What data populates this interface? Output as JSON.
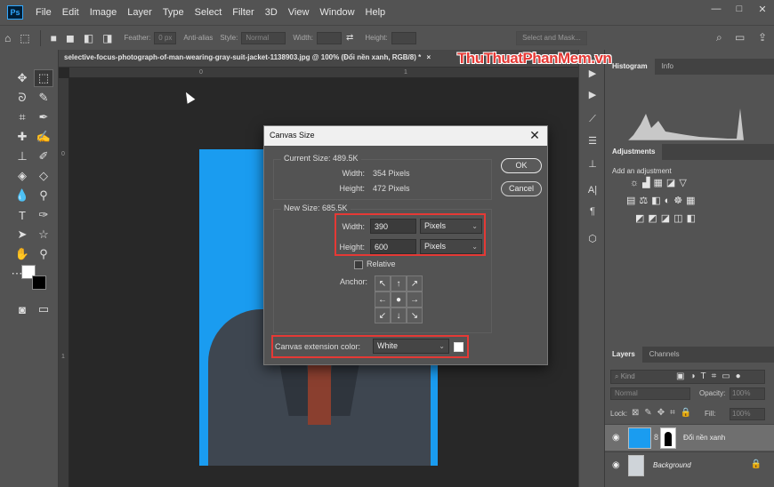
{
  "menubar": {
    "logo": "Ps",
    "items": [
      "File",
      "Edit",
      "Image",
      "Layer",
      "Type",
      "Select",
      "Filter",
      "3D",
      "View",
      "Window",
      "Help"
    ],
    "minimize": "—",
    "maximize": "□",
    "close": "✕"
  },
  "options": {
    "feather_label": "Feather:",
    "feather_value": "0 px",
    "antialias_label": "Anti-alias",
    "style_label": "Style:",
    "style_value": "Normal",
    "width_label": "Width:",
    "height_label": "Height:",
    "select_mask": "Select and Mask..."
  },
  "document": {
    "tab_title": "selective-focus-photograph-of-man-wearing-gray-suit-jacket-1138903.jpg @ 100% (Đổi nền xanh, RGB/8) *",
    "tab_close": "×",
    "watermark": "ThuThuatPhanMem.vn",
    "ruler_top": [
      "0",
      "1"
    ],
    "ruler_left": [
      "0",
      "1"
    ]
  },
  "dialog": {
    "title": "Canvas Size",
    "close": "✕",
    "current_size_label": "Current Size: 489.5K",
    "current_width_label": "Width:",
    "current_width_value": "354 Pixels",
    "current_height_label": "Height:",
    "current_height_value": "472 Pixels",
    "new_size_label": "New Size: 685.5K",
    "width_label": "Width:",
    "width_value": "390",
    "width_unit": "Pixels",
    "height_label": "Height:",
    "height_value": "600",
    "height_unit": "Pixels",
    "relative_label": "Relative",
    "anchor_label": "Anchor:",
    "ext_color_label": "Canvas extension color:",
    "ext_color_value": "White",
    "ok": "OK",
    "cancel": "Cancel"
  },
  "right": {
    "top_tabs": [
      "Histogram",
      "Info"
    ],
    "adj_tab": "Adjustments",
    "adj_subtitle": "Add an adjustment",
    "layers_tabs": [
      "Layers",
      "Channels"
    ],
    "layers_kind": "Kind",
    "blend_mode": "Normal",
    "opacity_label": "Opacity:",
    "opacity_value": "100%",
    "lock_label": "Lock:",
    "fill_label": "Fill:",
    "fill_value": "100%",
    "layers": [
      {
        "name": "Đổi nền xanh",
        "selected": true
      },
      {
        "name": "Background",
        "selected": false
      }
    ]
  },
  "colors": {
    "canvas_blue": "#1a9cf0",
    "highlight_red": "#e53935",
    "ui_bg": "#535353"
  }
}
